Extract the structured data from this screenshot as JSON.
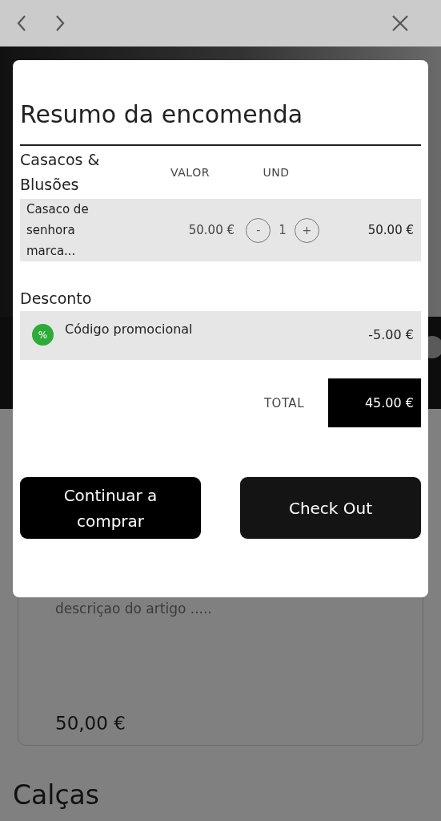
{
  "modal": {
    "title": "Resumo da encomenda",
    "section": {
      "title": "Casacos & Blusões",
      "columns": [
        "VALOR",
        "UND"
      ]
    },
    "items": [
      {
        "name": "Casaco de senhora marca...",
        "price": "50.00 €",
        "decrement": "-",
        "quantity": "1",
        "increment": "+",
        "subtotal": "50.00 €"
      }
    ],
    "discount": {
      "title": "Desconto",
      "items": [
        {
          "icon": "%",
          "name": "Código promocional",
          "amount": "-5.00 €"
        }
      ]
    },
    "total": {
      "label": "TOTAL",
      "value": "45.00 €"
    },
    "buttons": [
      {
        "label": "Continuar a comprar",
        "kind": "secondary"
      },
      {
        "label": "Check Out",
        "kind": "primary"
      }
    ]
  },
  "page": {
    "card": {
      "description": "descriçao do artigo .....",
      "price": "50,00 €"
    },
    "section_title": "Calças"
  }
}
